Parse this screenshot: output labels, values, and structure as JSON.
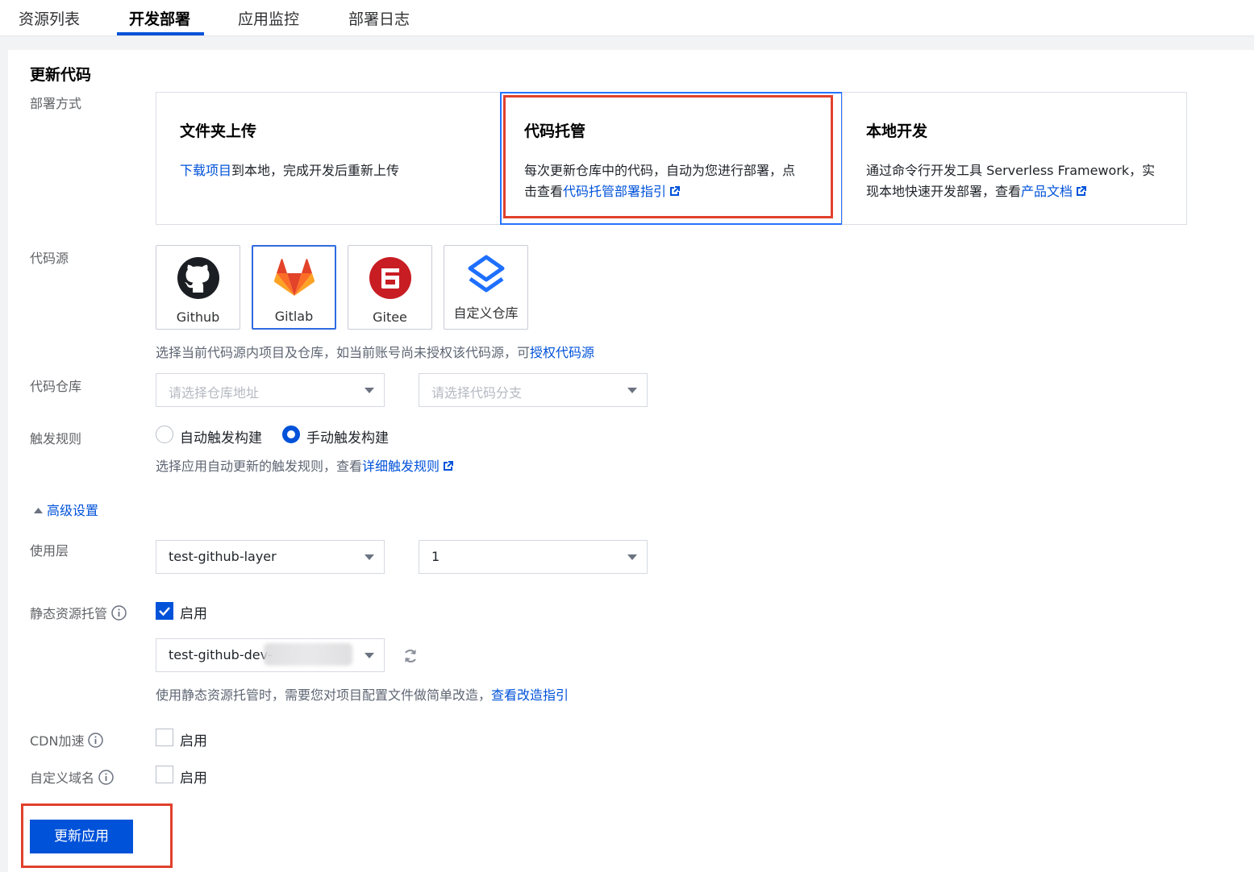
{
  "tabs": [
    {
      "label": "资源列表",
      "active": false
    },
    {
      "label": "开发部署",
      "active": true
    },
    {
      "label": "应用监控",
      "active": false
    },
    {
      "label": "部署日志",
      "active": false
    }
  ],
  "section_title": "更新代码",
  "deploy_mode": {
    "label": "部署方式",
    "options": [
      {
        "title": "文件夹上传",
        "link": "下载项目",
        "desc": "到本地，完成开发后重新上传"
      },
      {
        "title": "代码托管",
        "desc1": "每次更新仓库中的代码，自动为您进行部署，点",
        "desc2": "击查看",
        "link": "代码托管部署指引",
        "selected": true
      },
      {
        "title": "本地开发",
        "desc1": "通过命令行开发工具 Serverless Framework，实",
        "desc2": "现本地快速开发部署，查看",
        "link": "产品文档"
      }
    ]
  },
  "code_source": {
    "label": "代码源",
    "cards": [
      {
        "label": "Github",
        "icon": "github-icon"
      },
      {
        "label": "Gitlab",
        "icon": "gitlab-icon",
        "selected": true
      },
      {
        "label": "Gitee",
        "icon": "gitee-icon"
      },
      {
        "label": "自定义仓库",
        "icon": "custom-repo-icon"
      }
    ],
    "hint": "选择当前代码源内项目及仓库，如当前账号尚未授权该代码源，可",
    "hint_link": "授权代码源"
  },
  "repo": {
    "label": "代码仓库",
    "repo_placeholder": "请选择仓库地址",
    "branch_placeholder": "请选择代码分支"
  },
  "trigger": {
    "label": "触发规则",
    "auto": "自动触发构建",
    "manual": "手动触发构建",
    "selected": "manual",
    "hint": "选择应用自动更新的触发规则，查看",
    "hint_link": "详细触发规则"
  },
  "advanced": {
    "label": "高级设置",
    "expanded": true
  },
  "layer": {
    "label": "使用层",
    "layer_value": "test-github-layer",
    "version_value": "1"
  },
  "static_hosting": {
    "label": "静态资源托管",
    "enable_label": "启用",
    "enabled": true,
    "bucket_value": "test-github-dev-",
    "hint": "使用静态资源托管时，需要您对项目配置文件做简单改造，",
    "hint_link": "查看改造指引"
  },
  "cdn": {
    "label": "CDN加速",
    "enable_label": "启用",
    "enabled": false
  },
  "custom_domain": {
    "label": "自定义域名",
    "enable_label": "启用",
    "enabled": false
  },
  "submit_label": "更新应用",
  "colors": {
    "primary": "#0052d9",
    "highlight_frame": "#e0412c"
  }
}
